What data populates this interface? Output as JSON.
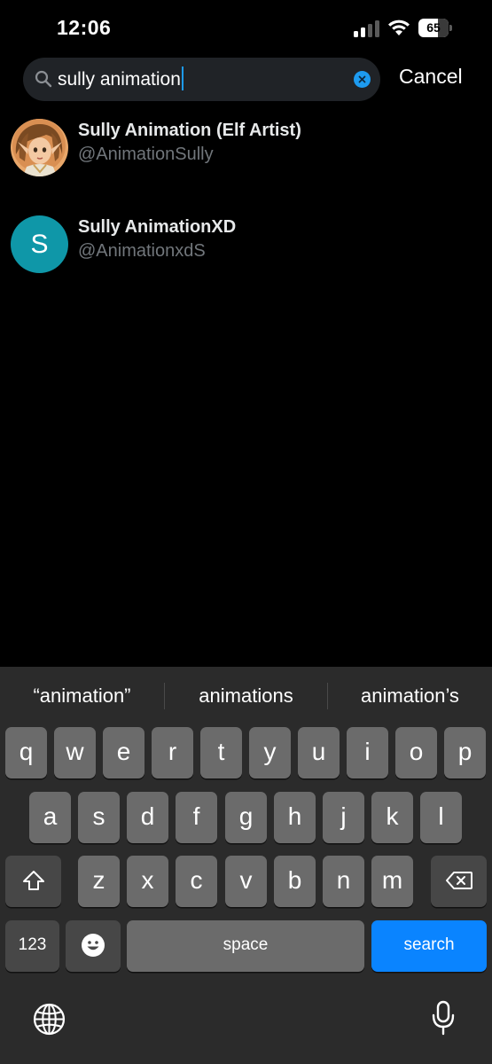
{
  "status_bar": {
    "time": "12:06",
    "battery_level": "65"
  },
  "search": {
    "query": "sully animation",
    "cancel_label": "Cancel"
  },
  "results": [
    {
      "name": "Sully Animation (Elf Artist)",
      "handle": "@AnimationSully",
      "avatar": "illustrated-elf-portrait"
    },
    {
      "name": "Sully AnimationXD",
      "handle": "@AnimationxdS",
      "avatar_letter": "S",
      "avatar_color": "#0f97a8"
    }
  ],
  "keyboard": {
    "suggestions": [
      "“animation”",
      "animations",
      "animation’s"
    ],
    "row1": [
      "q",
      "w",
      "e",
      "r",
      "t",
      "y",
      "u",
      "i",
      "o",
      "p"
    ],
    "row2": [
      "a",
      "s",
      "d",
      "f",
      "g",
      "h",
      "j",
      "k",
      "l"
    ],
    "row3": [
      "z",
      "x",
      "c",
      "v",
      "b",
      "n",
      "m"
    ],
    "numbers_label": "123",
    "space_label": "space",
    "search_label": "search",
    "accent_color": "#0a84ff"
  }
}
